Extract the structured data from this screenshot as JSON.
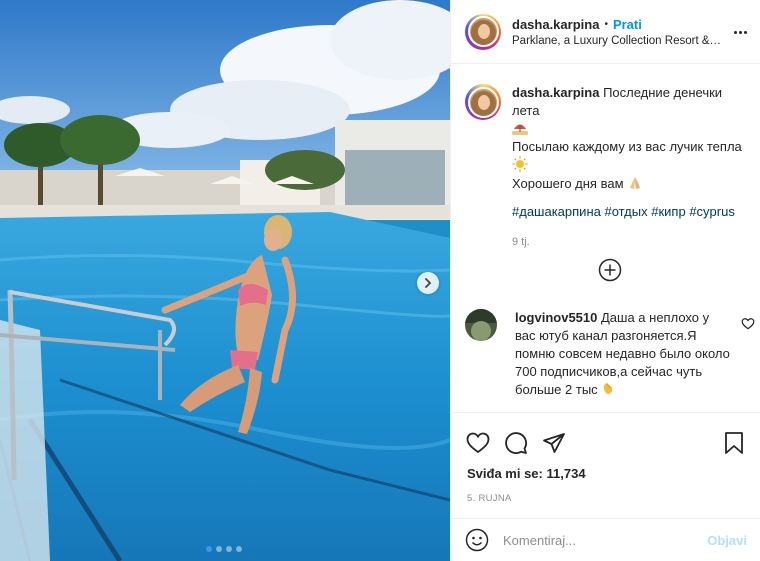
{
  "post": {
    "username": "dasha.karpina",
    "separator": "•",
    "follow_label": "Prati",
    "location": "Parklane, a Luxury Collection Resort & ..."
  },
  "caption": {
    "username": "dasha.karpina",
    "line1": "Последние денечки лета",
    "line2": "Посылаю каждому из вас лучик тепла",
    "line3": "Хорошего дня вам",
    "emoji_icons": [
      "beach-umbrella-icon",
      "sun-icon",
      "folded-hands-icon"
    ],
    "hashtags": [
      "#дашакарпина",
      "#отдых",
      "#кипр",
      "#cyprus"
    ],
    "age": "9 tj."
  },
  "comment": {
    "username": "logvinov5510",
    "text": "Даша а неплохо у вас ютуб канал разгоняется.Я помню совсем недавно было около 700 подписчиков,а сейчас чуть больше 2 тыс",
    "emoji_icon": "clapping-hands-icon"
  },
  "engagement": {
    "likes_label": "Sviđa mi se:",
    "likes_count": "11,734",
    "date": "5. RUJNA"
  },
  "add_comment": {
    "placeholder": "Komentiraj...",
    "post_label": "Objavi"
  },
  "carousel": {
    "slides": 4,
    "active_slide": 1
  },
  "colors": {
    "link_blue": "#0095f6",
    "hashtag": "#00376b",
    "muted": "#8e8e8e",
    "post_disabled": "#b2dffc"
  }
}
